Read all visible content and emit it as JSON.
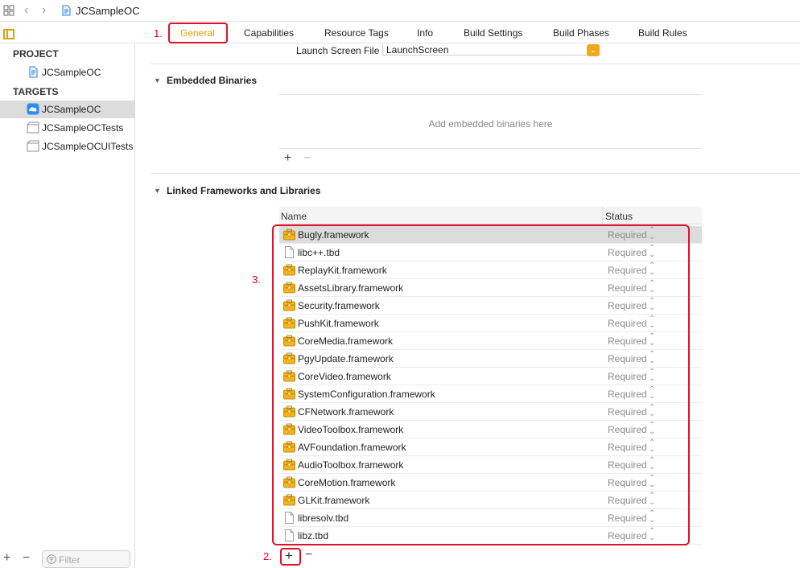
{
  "breadcrumb": {
    "project": "JCSampleOC"
  },
  "tabs": [
    "General",
    "Capabilities",
    "Resource Tags",
    "Info",
    "Build Settings",
    "Build Phases",
    "Build Rules"
  ],
  "annotations": {
    "step1": "1.",
    "step2": "2.",
    "step3": "3."
  },
  "sidebar": {
    "project_header": "PROJECT",
    "project_item": "JCSampleOC",
    "targets_header": "TARGETS",
    "targets": [
      "JCSampleOC",
      "JCSampleOCTests",
      "JCSampleOCUITests"
    ],
    "filter_placeholder": "Filter"
  },
  "general": {
    "launch_label": "Launch Screen File",
    "launch_value": "LaunchScreen",
    "embedded_title": "Embedded Binaries",
    "embedded_empty": "Add embedded binaries here",
    "linked_title": "Linked Frameworks and Libraries",
    "col_name": "Name",
    "col_status": "Status",
    "libraries": [
      {
        "name": "Bugly.framework",
        "status": "Required",
        "kind": "framework"
      },
      {
        "name": "libc++.tbd",
        "status": "Required",
        "kind": "file"
      },
      {
        "name": "ReplayKit.framework",
        "status": "Required",
        "kind": "framework"
      },
      {
        "name": "AssetsLibrary.framework",
        "status": "Required",
        "kind": "framework"
      },
      {
        "name": "Security.framework",
        "status": "Required",
        "kind": "framework"
      },
      {
        "name": "PushKit.framework",
        "status": "Required",
        "kind": "framework"
      },
      {
        "name": "CoreMedia.framework",
        "status": "Required",
        "kind": "framework"
      },
      {
        "name": "PgyUpdate.framework",
        "status": "Required",
        "kind": "framework"
      },
      {
        "name": "CoreVideo.framework",
        "status": "Required",
        "kind": "framework"
      },
      {
        "name": "SystemConfiguration.framework",
        "status": "Required",
        "kind": "framework"
      },
      {
        "name": "CFNetwork.framework",
        "status": "Required",
        "kind": "framework"
      },
      {
        "name": "VideoToolbox.framework",
        "status": "Required",
        "kind": "framework"
      },
      {
        "name": "AVFoundation.framework",
        "status": "Required",
        "kind": "framework"
      },
      {
        "name": "AudioToolbox.framework",
        "status": "Required",
        "kind": "framework"
      },
      {
        "name": "CoreMotion.framework",
        "status": "Required",
        "kind": "framework"
      },
      {
        "name": "GLKit.framework",
        "status": "Required",
        "kind": "framework"
      },
      {
        "name": "libresolv.tbd",
        "status": "Required",
        "kind": "file"
      },
      {
        "name": "libz.tbd",
        "status": "Required",
        "kind": "file"
      }
    ]
  },
  "colors": {
    "accent": "#e0a000",
    "annotation": "#e2102a",
    "selection": "#dcdcdc"
  }
}
